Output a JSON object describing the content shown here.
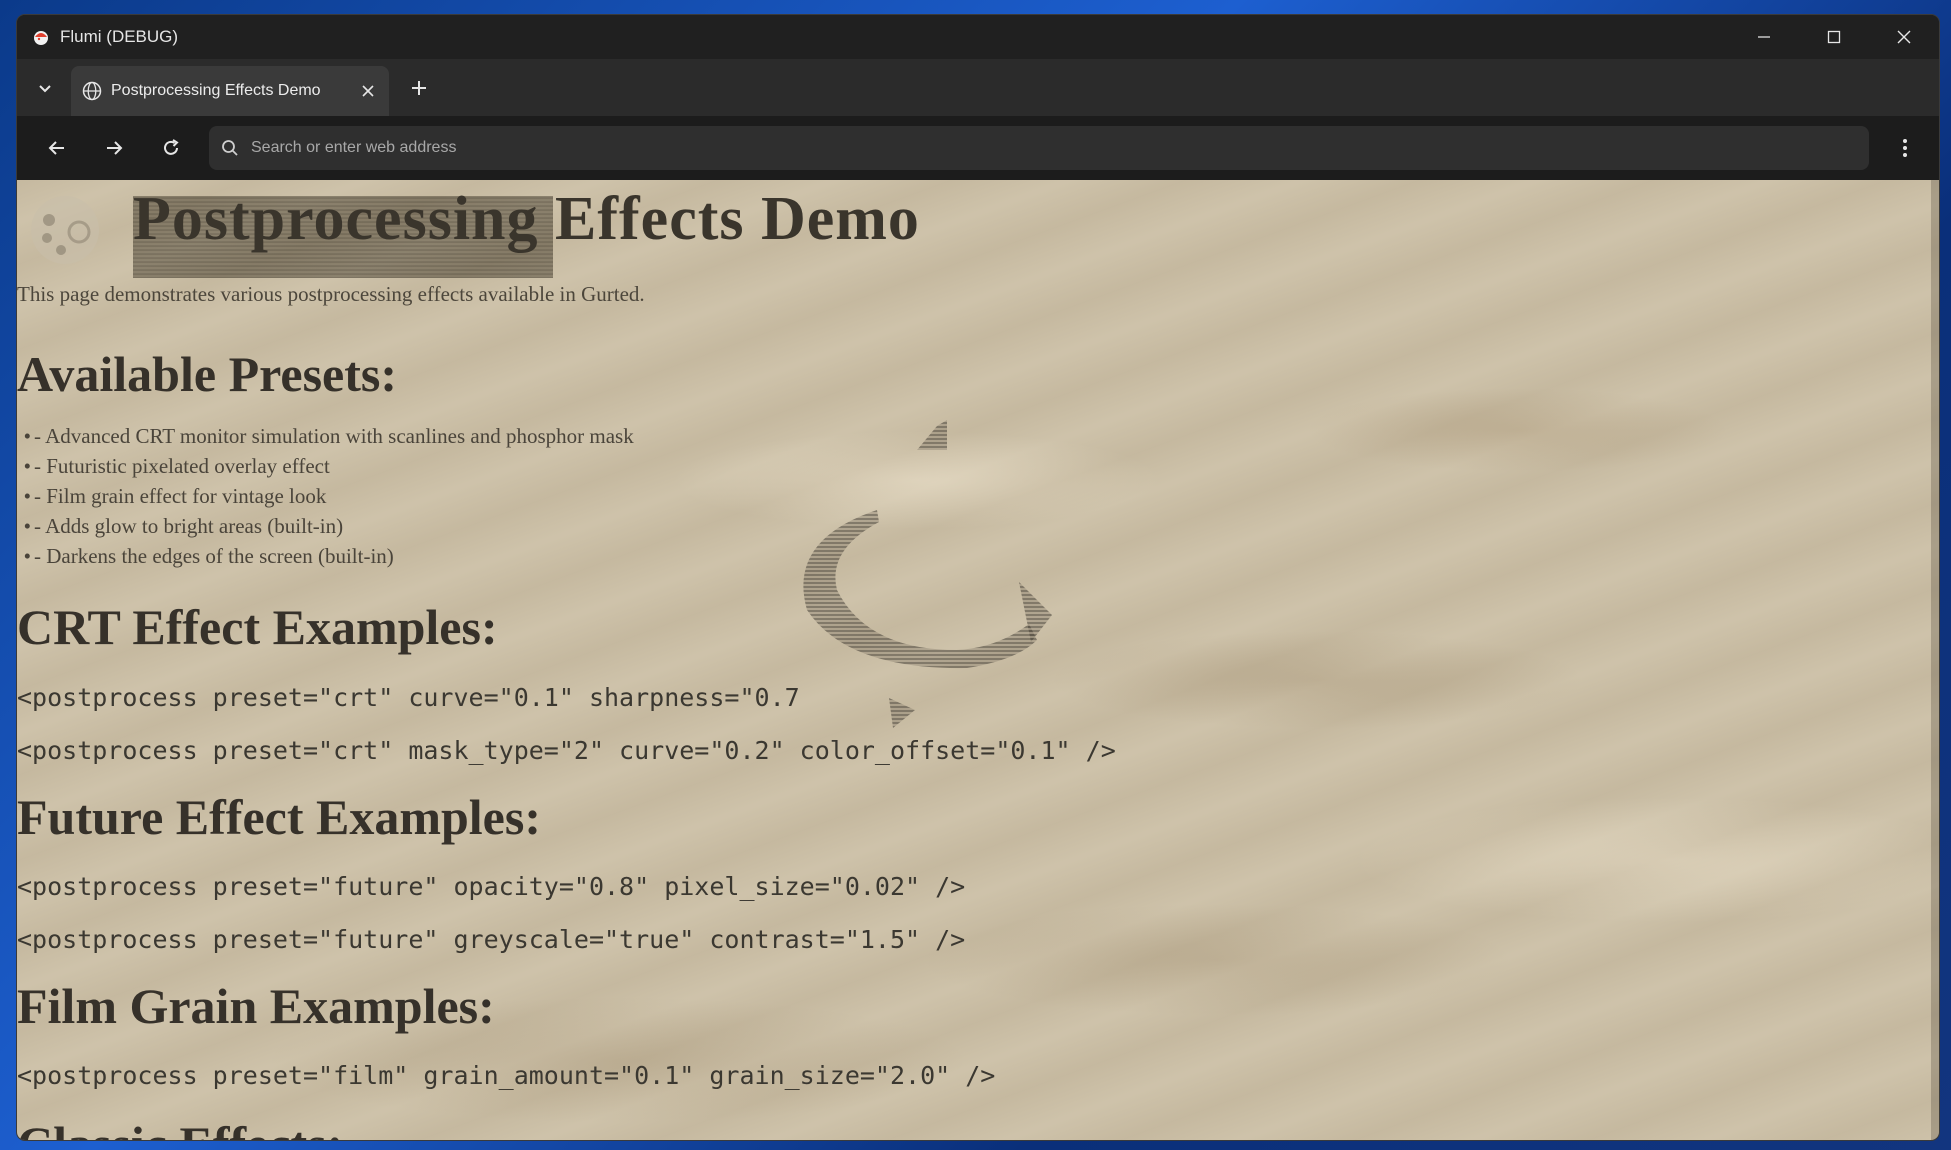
{
  "window": {
    "title": "Flumi (DEBUG)"
  },
  "tabs": [
    {
      "title": "Postprocessing Effects Demo"
    }
  ],
  "toolbar": {
    "search_placeholder": "Search or enter web address"
  },
  "page": {
    "title": "Postprocessing Effects Demo",
    "intro": "This page demonstrates various postprocessing effects available in Gurted.",
    "presets_heading": "Available Presets:",
    "presets": [
      "- Advanced CRT monitor simulation with scanlines and phosphor mask",
      "- Futuristic pixelated overlay effect",
      "- Film grain effect for vintage look",
      "- Adds glow to bright areas (built-in)",
      "- Darkens the edges of the screen (built-in)"
    ],
    "bullet": "•",
    "crt_heading": "CRT Effect Examples:",
    "crt_examples": [
      "<postprocess preset=\"crt\" curve=\"0.1\" sharpness=\"0.7",
      "<postprocess preset=\"crt\" mask_type=\"2\" curve=\"0.2\" color_offset=\"0.1\" />"
    ],
    "future_heading": "Future Effect Examples:",
    "future_examples": [
      "<postprocess preset=\"future\" opacity=\"0.8\" pixel_size=\"0.02\" />",
      "<postprocess preset=\"future\" greyscale=\"true\" contrast=\"1.5\" />"
    ],
    "film_heading": "Film Grain Examples:",
    "film_examples": [
      "<postprocess preset=\"film\" grain_amount=\"0.1\" grain_size=\"2.0\" />"
    ],
    "classic_heading": "Classic Effects:"
  },
  "colors": {
    "page_background": "#cbbfa6",
    "heading_text": "#36312a",
    "body_text": "#4a443a",
    "chrome_dark": "#1f1f1f"
  }
}
